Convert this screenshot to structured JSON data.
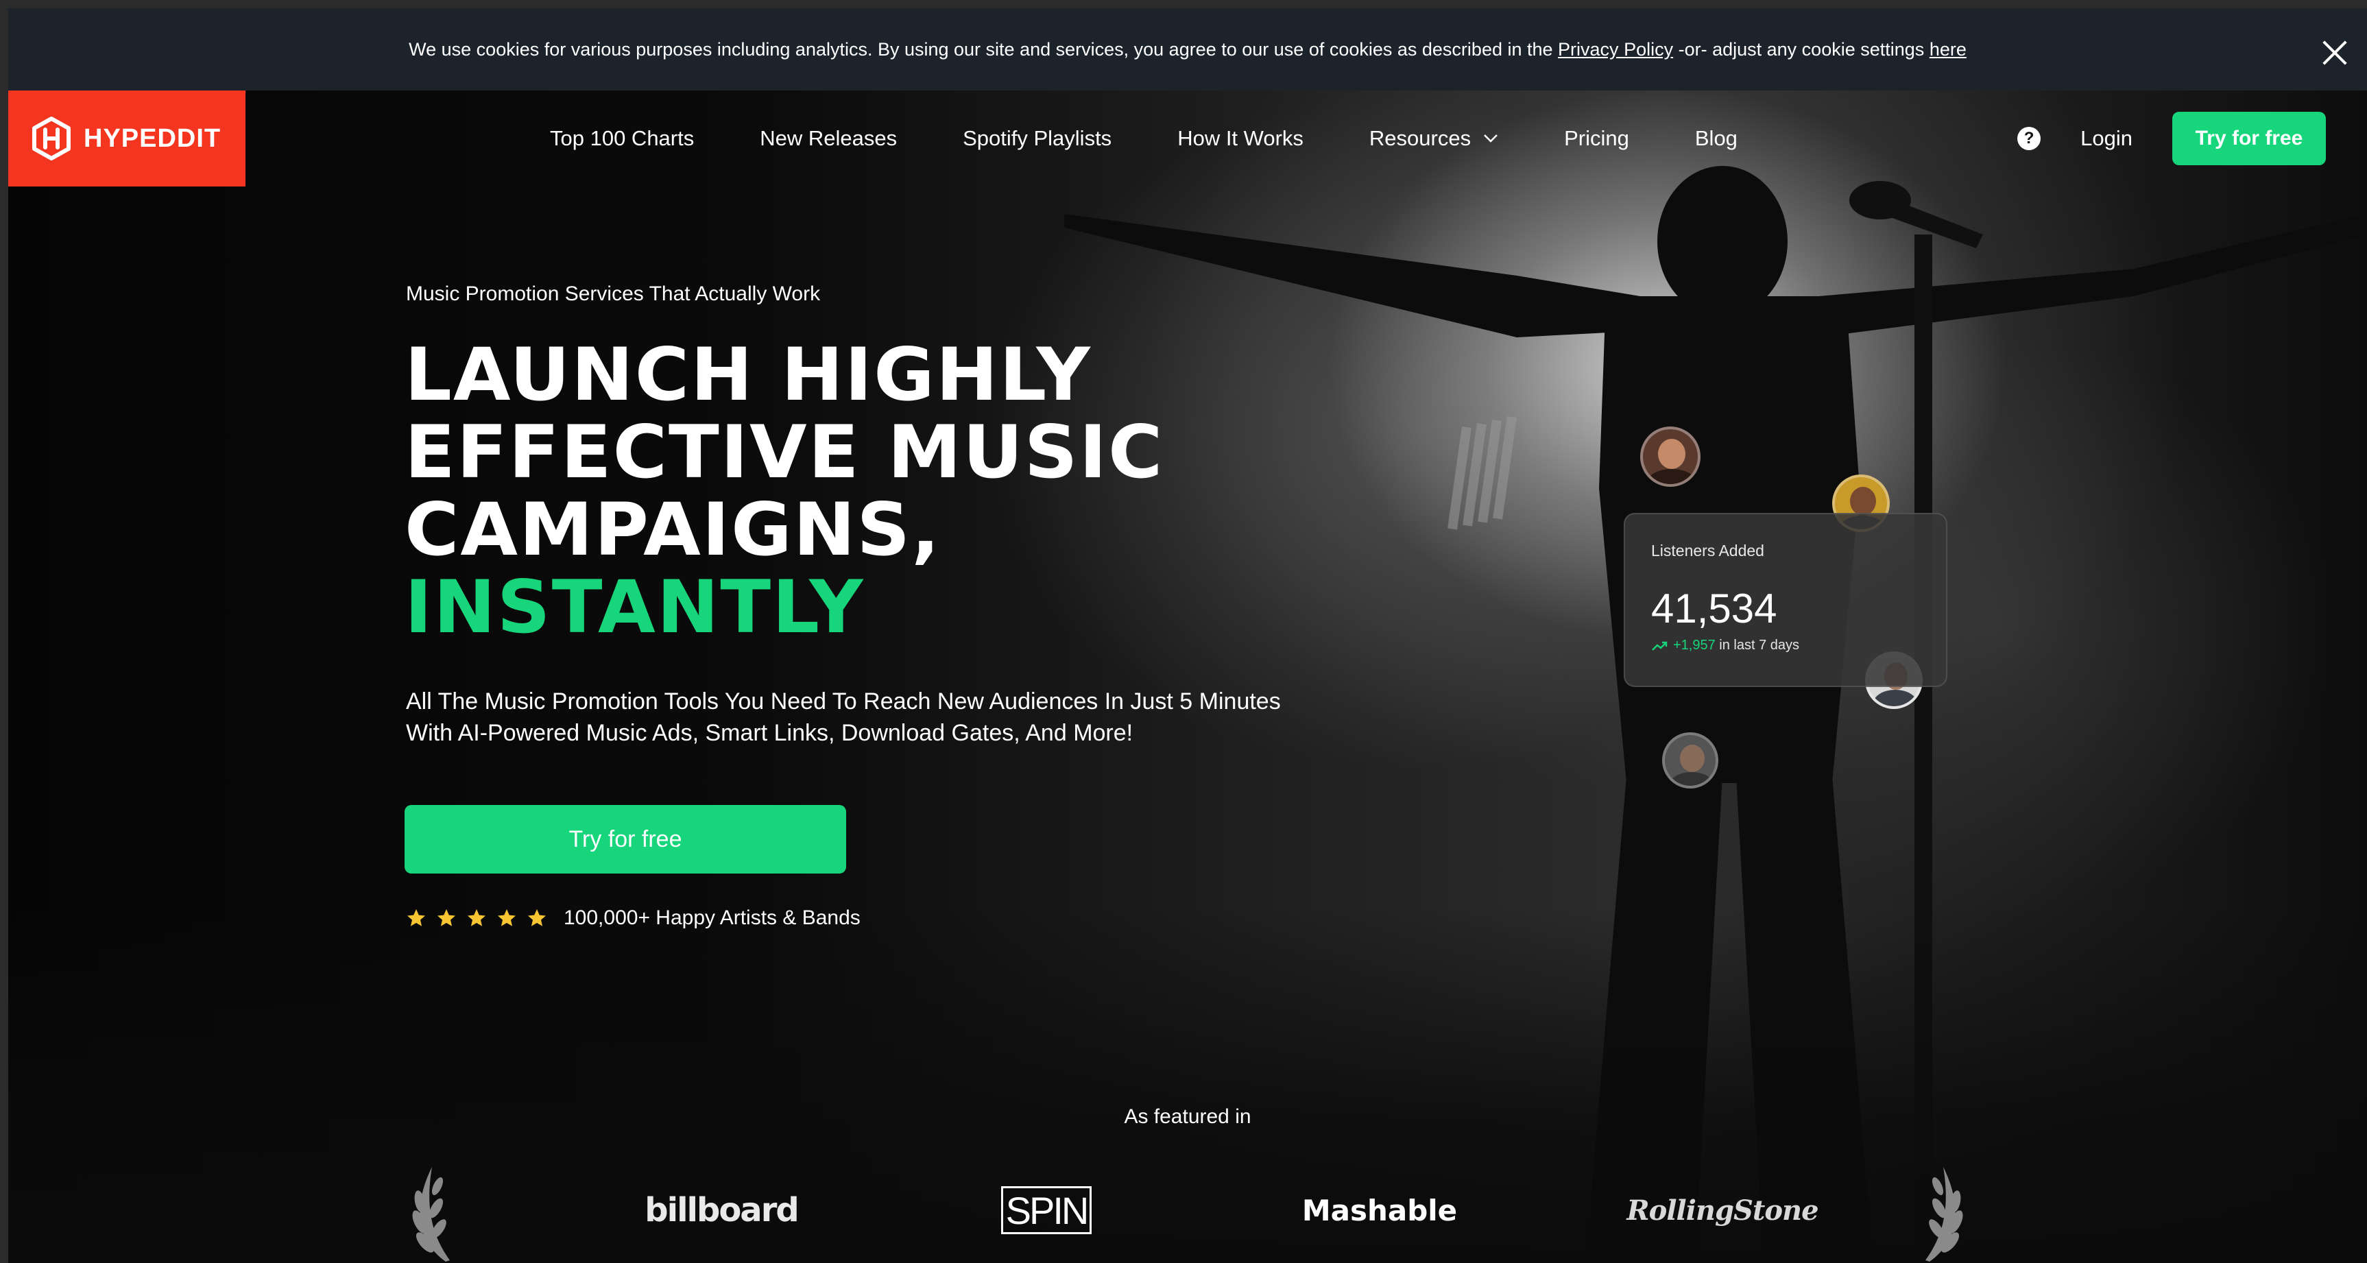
{
  "cookie_banner": {
    "text_before": "We use cookies for various purposes including analytics. By using our site and services, you agree to our use of cookies as described in the",
    "privacy_link": "Privacy Policy",
    "text_middle": "-or- adjust any cookie settings",
    "here_link": "here",
    "close_icon": "close-icon"
  },
  "nav": {
    "logo_text": "HYPEDDIT",
    "links": [
      "Top 100 Charts",
      "New Releases",
      "Spotify Playlists",
      "How It Works",
      "Resources",
      "Pricing",
      "Blog"
    ],
    "help_label": "?",
    "login_label": "Login",
    "cta_label": "Try for free"
  },
  "hero": {
    "eyebrow": "Music Promotion Services That Actually Work",
    "headline_lines": [
      "LAUNCH HIGHLY",
      "EFFECTIVE MUSIC",
      "CAMPAIGNS,"
    ],
    "headline_accent": "INSTANTLY",
    "subtext_line1": "All The Music Promotion Tools You Need To Reach New Audiences In Just 5 Minutes",
    "subtext_line2": "With AI-Powered Music Ads, Smart Links, Download Gates, And More!",
    "cta_label": "Try for free",
    "rating_stars": 5,
    "rating_text": "100,000+ Happy Artists & Bands"
  },
  "stats_card": {
    "label": "Listeners Added",
    "value": "41,534",
    "delta": "+1,957",
    "delta_suffix": "in last 7 days"
  },
  "featured": {
    "title": "As featured in",
    "publications": [
      "billboard",
      "SPIN",
      "Mashable",
      "RollingStone"
    ]
  },
  "colors": {
    "accent_green": "#16d57a",
    "brand_red": "#f4351f",
    "cookie_bg": "#1d232b",
    "star_yellow": "#f7c531"
  }
}
